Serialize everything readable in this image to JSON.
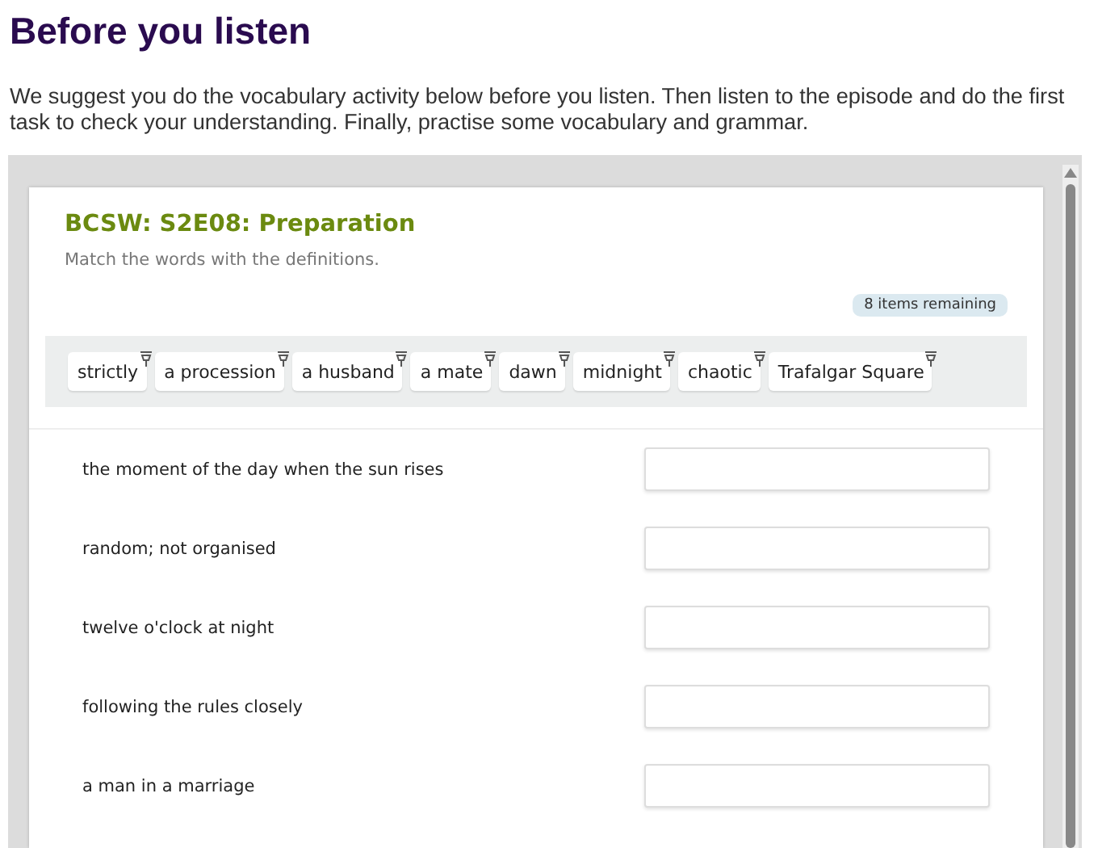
{
  "heading": "Before you listen",
  "intro": "We suggest you do the vocabulary activity below before you listen. Then listen to the episode and do the first task to check your understanding. Finally, practise some vocabulary and grammar.",
  "activity": {
    "title": "BCSW: S2E08: Preparation",
    "instruction": "Match the words with the definitions.",
    "remaining": "8 items remaining",
    "words": [
      "strictly",
      "a procession",
      "a husband",
      "a mate",
      "dawn",
      "midnight",
      "chaotic",
      "Trafalgar Square"
    ],
    "definitions": [
      "the moment of the day when the sun rises",
      "random; not organised",
      "twelve o'clock at night",
      "following the rules closely",
      "a man in a marriage"
    ]
  }
}
